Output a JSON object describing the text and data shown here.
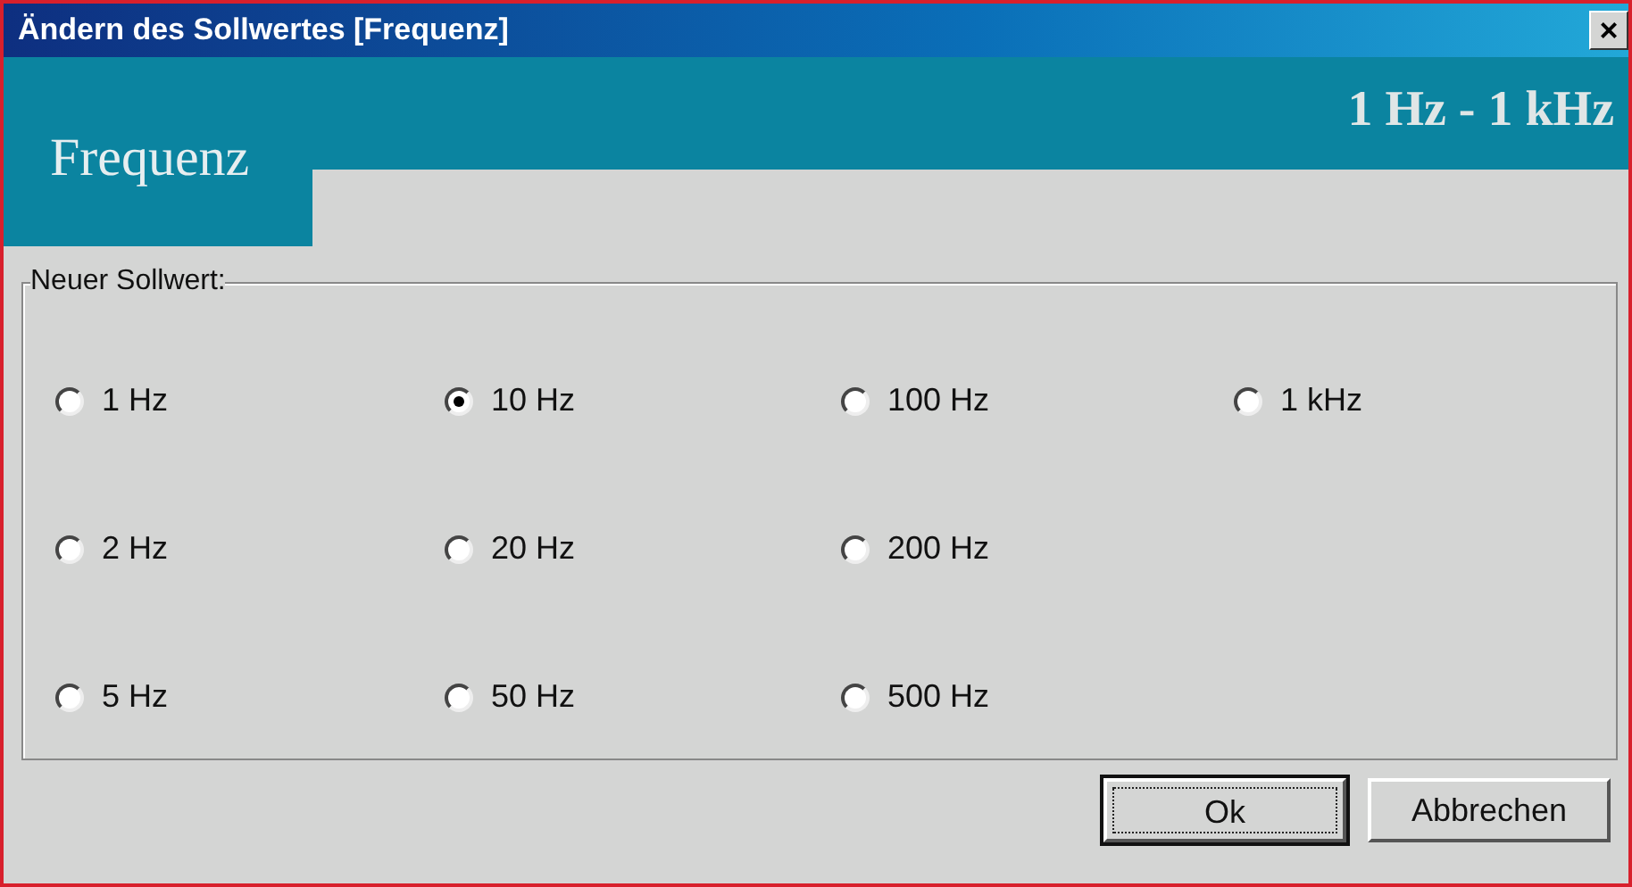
{
  "window": {
    "title": "Ändern des Sollwertes [Frequenz]",
    "close": "×"
  },
  "header": {
    "tab": "Frequenz",
    "range": "1 Hz - 1 kHz"
  },
  "group": {
    "label": "Neuer Sollwert:",
    "rows": [
      [
        {
          "label": "1 Hz",
          "selected": false
        },
        {
          "label": "10 Hz",
          "selected": true
        },
        {
          "label": "100 Hz",
          "selected": false
        },
        {
          "label": "1 kHz",
          "selected": false
        }
      ],
      [
        {
          "label": "2 Hz",
          "selected": false
        },
        {
          "label": "20 Hz",
          "selected": false
        },
        {
          "label": "200 Hz",
          "selected": false
        }
      ],
      [
        {
          "label": "5 Hz",
          "selected": false
        },
        {
          "label": "50 Hz",
          "selected": false
        },
        {
          "label": "500 Hz",
          "selected": false
        }
      ]
    ]
  },
  "buttons": [
    {
      "label": "Ok",
      "default": true
    },
    {
      "label": "Abbrechen",
      "default": false
    }
  ]
}
